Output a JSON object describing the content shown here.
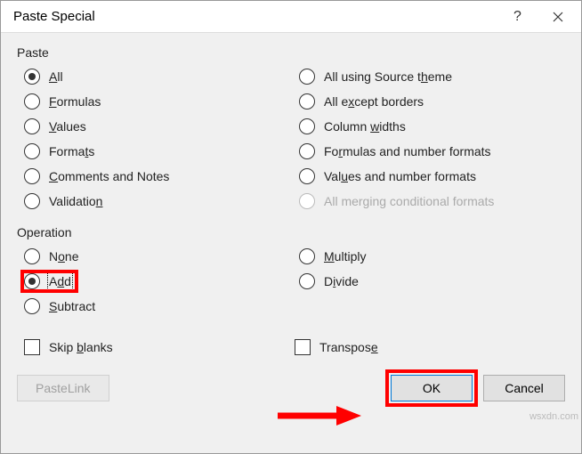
{
  "title": "Paste Special",
  "sections": {
    "paste": {
      "label": "Paste",
      "options": {
        "all": "All",
        "all_source_theme": "All using Source theme",
        "formulas": "Formulas",
        "all_except_borders": "All except borders",
        "values": "Values",
        "column_widths": "Column widths",
        "formats": "Formats",
        "formulas_number_formats": "Formulas and number formats",
        "comments_notes": "Comments and Notes",
        "values_number_formats": "Values and number formats",
        "validation": "Validation",
        "all_merging_conditional": "All merging conditional formats"
      }
    },
    "operation": {
      "label": "Operation",
      "options": {
        "none": "None",
        "multiply": "Multiply",
        "add": "Add",
        "divide": "Divide",
        "subtract": "Subtract"
      }
    }
  },
  "checkboxes": {
    "skip_blanks": "Skip blanks",
    "transpose": "Transpose"
  },
  "buttons": {
    "paste_link": "Paste Link",
    "ok": "OK",
    "cancel": "Cancel"
  },
  "watermark": "wsxdn.com"
}
